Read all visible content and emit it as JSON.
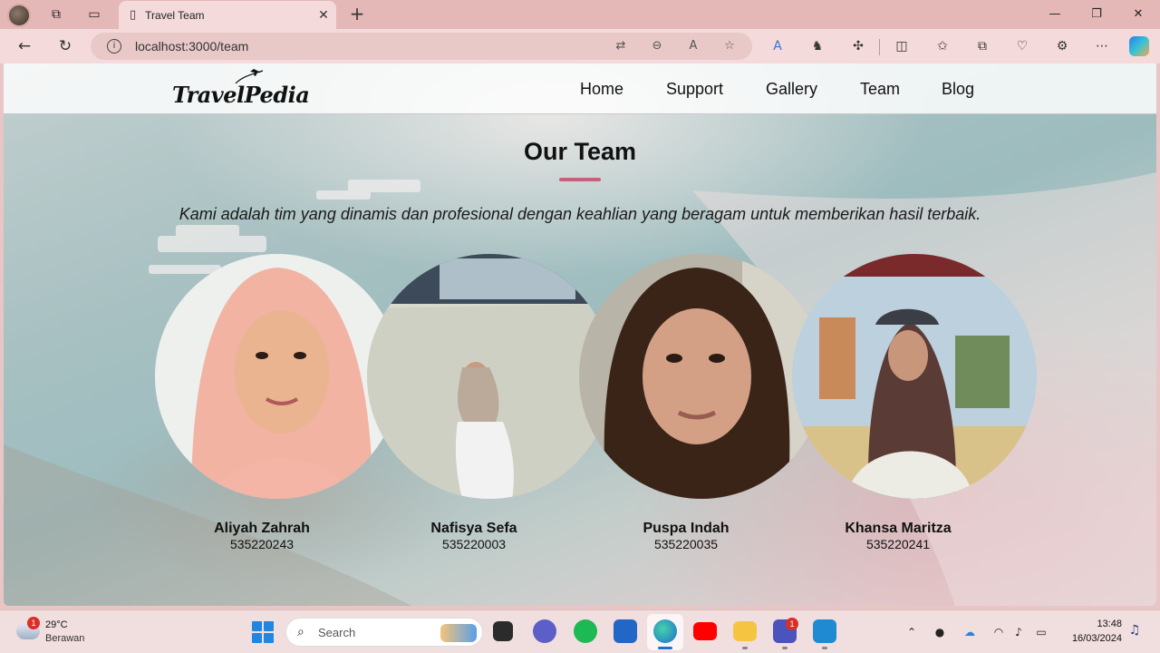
{
  "browser": {
    "tab_title": "Travel Team",
    "url": "localhost:3000/team"
  },
  "site": {
    "logo_text": "TravelPedia",
    "nav": [
      "Home",
      "Support",
      "Gallery",
      "Team",
      "Blog"
    ]
  },
  "team": {
    "title": "Our Team",
    "tagline": "Kami adalah tim yang dinamis dan profesional dengan keahlian yang beragam untuk memberikan hasil terbaik.",
    "members": [
      {
        "name": "Aliyah Zahrah",
        "nim": "535220243"
      },
      {
        "name": "Nafisya Sefa",
        "nim": "535220003"
      },
      {
        "name": "Puspa Indah",
        "nim": "535220035"
      },
      {
        "name": "Khansa Maritza",
        "nim": "535220241"
      }
    ]
  },
  "taskbar": {
    "weather_temp": "29°C",
    "weather_desc": "Berawan",
    "weather_badge": "1",
    "search_placeholder": "Search",
    "teams_badge": "1",
    "time": "13:48",
    "date": "16/03/2024"
  },
  "colors": {
    "accent_underline": "#c7607a",
    "chrome_titlebar": "#e5b8b8",
    "chrome_toolbar": "#f4dada"
  }
}
